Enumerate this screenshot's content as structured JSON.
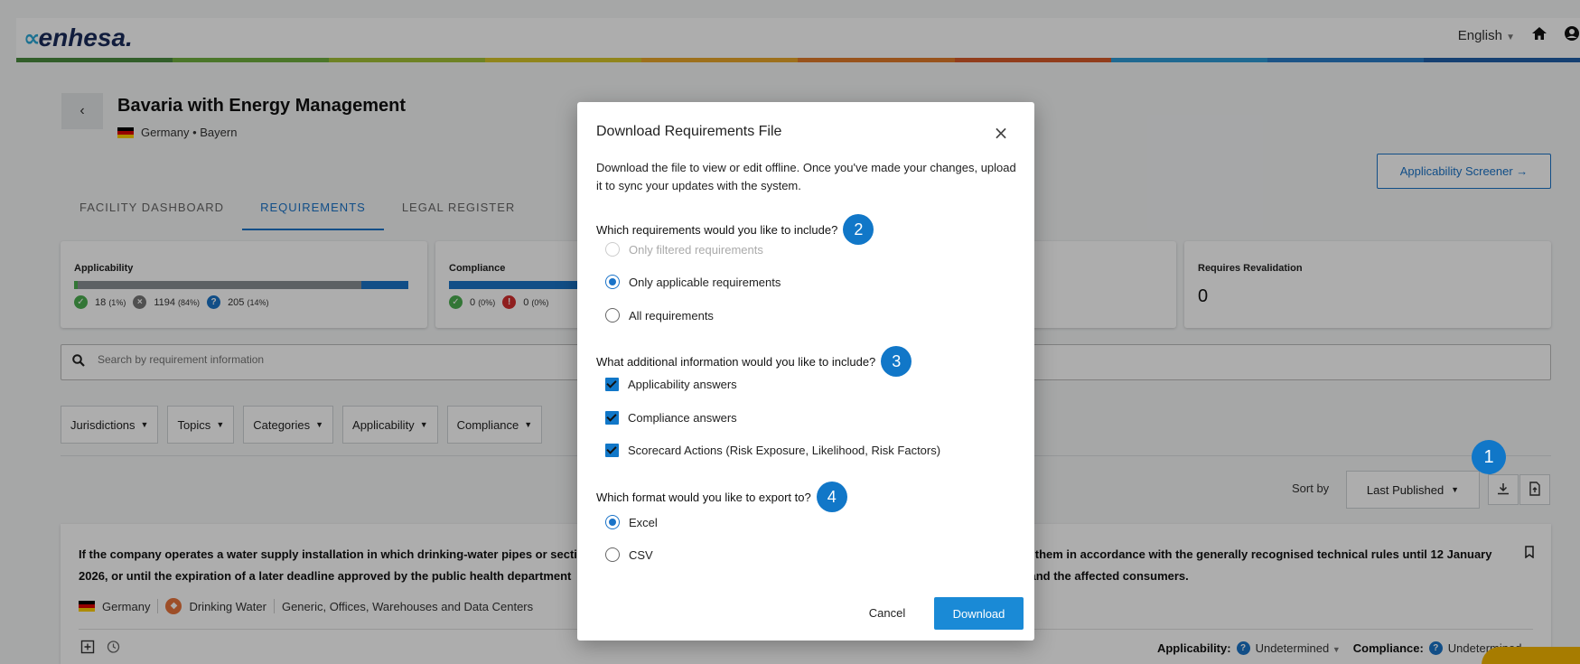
{
  "app": {
    "logo_mark": "∝",
    "logo_text": "enhesa.",
    "strip_colors": [
      "#4a8b3f",
      "#6fae3f",
      "#a2c037",
      "#d5c52a",
      "#e8a52a",
      "#e07b2a",
      "#d65a2a",
      "#2e9bd6",
      "#2a7cc8",
      "#1f5fa8"
    ],
    "language": "English",
    "home_icon": "home-icon",
    "user_icon": "user-icon"
  },
  "facility": {
    "title": "Bavaria with Energy Management",
    "location": "Germany • Bayern"
  },
  "screener_button": "Applicability Screener →",
  "tabs": [
    {
      "label": "FACILITY DASHBOARD"
    },
    {
      "label": "REQUIREMENTS"
    },
    {
      "label": "LEGAL REGISTER"
    }
  ],
  "cards": {
    "applicability": {
      "title": "Applicability",
      "fractions": [
        0.01,
        0.84,
        0.14
      ],
      "yes": "18",
      "yes_pct": "(1%)",
      "no": "1194",
      "no_pct": "(84%)",
      "unknown": "205",
      "unknown_pct": "(14%)"
    },
    "compliance": {
      "title": "Compliance",
      "ok": "0",
      "ok_pct": "(0%)",
      "bad": "0",
      "bad_pct": "(0%)"
    },
    "revalidation": {
      "title": "Requires Revalidation",
      "value": "0"
    }
  },
  "search": {
    "placeholder": "Search by requirement information"
  },
  "filters": [
    "Jurisdictions",
    "Topics",
    "Categories",
    "Applicability",
    "Compliance"
  ],
  "sort": {
    "label": "Sort by",
    "value": "Last Published"
  },
  "requirement": {
    "text_left_1": "If the company operates a water supply installation in which drinking-water pipes or secti",
    "text_right_1": "s them in accordance with the generally recognised technical rules until 12 January",
    "text_left_2": "2026, or until the expiration of a later deadline approved by the public health department",
    "text_right_2": "ent and the affected consumers.",
    "country": "Germany",
    "topic": "Drinking Water",
    "scope": "Generic, Offices, Warehouses and Data Centers",
    "applicability_label": "Applicability:",
    "applicability_value": "Undetermined",
    "compliance_label": "Compliance:",
    "compliance_value": "Undetermined"
  },
  "modal": {
    "title": "Download Requirements File",
    "close": "×",
    "description": "Download the file to view or edit offline. Once you've made your changes, upload it to sync your updates with the system.",
    "q1": "Which requirements would you like to include?",
    "q1_step": "2",
    "q1_options": [
      "Only filtered requirements",
      "Only applicable requirements",
      "All requirements"
    ],
    "q2": "What additional information would you like to include?",
    "q2_step": "3",
    "q2_options": [
      "Applicability answers",
      "Compliance answers",
      "Scorecard Actions (Risk Exposure, Likelihood, Risk Factors)"
    ],
    "q3": "Which format would you like to export to?",
    "q3_step": "4",
    "q3_options": [
      "Excel",
      "CSV"
    ],
    "cancel": "Cancel",
    "download": "Download"
  },
  "step_marker": "1"
}
